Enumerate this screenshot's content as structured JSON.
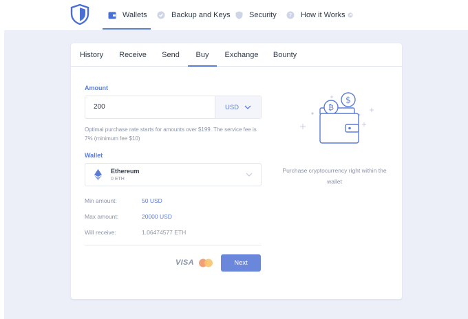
{
  "nav": {
    "items": [
      {
        "label": "Wallets",
        "icon": "wallet-icon",
        "active": true
      },
      {
        "label": "Backup and Keys",
        "icon": "backup-icon",
        "active": false
      },
      {
        "label": "Security",
        "icon": "shield-icon",
        "active": false
      },
      {
        "label": "How it Works",
        "icon": "help-icon",
        "active": false
      }
    ]
  },
  "tabs": [
    {
      "label": "History",
      "active": false
    },
    {
      "label": "Receive",
      "active": false
    },
    {
      "label": "Send",
      "active": false
    },
    {
      "label": "Buy",
      "active": true
    },
    {
      "label": "Exchange",
      "active": false
    },
    {
      "label": "Bounty",
      "active": false
    }
  ],
  "buy": {
    "amount_label": "Amount",
    "amount_value": "200",
    "currency": "USD",
    "note": "Optimal purchase rate starts for amounts over $199. The service fee is 7% (minimum fee $10)",
    "wallet_label": "Wallet",
    "wallet_name": "Ethereum",
    "wallet_balance": "0 ETH",
    "min_label": "Min amount:",
    "min_value": "50 USD",
    "max_label": "Max amount:",
    "max_value": "20000 USD",
    "receive_label": "Will receive:",
    "receive_value": "1.06474577 ETH",
    "visa": "VISA",
    "next_label": "Next"
  },
  "illustration": {
    "caption": "Purchase cryptocurrency right within the wallet"
  },
  "colors": {
    "accent": "#5b7cd6",
    "background": "#eceef8",
    "button": "#6a87dc"
  }
}
